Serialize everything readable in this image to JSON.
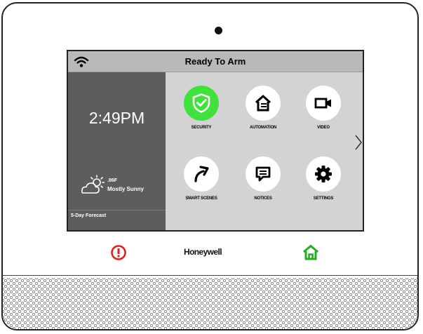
{
  "status_bar": {
    "title": "Ready To Arm",
    "wifi_icon": "wifi-icon"
  },
  "left_panel": {
    "time": "2:49PM",
    "weather": {
      "temperature": ".86F",
      "condition": "Mostly Sunny",
      "icon": "partly-sunny-icon"
    },
    "forecast_label": "5-Day Forecast"
  },
  "tiles": [
    {
      "label": "SECURITY",
      "icon": "shield-check-icon",
      "active": true
    },
    {
      "label": "AUTOMATION",
      "icon": "home-automation-icon",
      "active": false
    },
    {
      "label": "VIDEO",
      "icon": "video-camera-icon",
      "active": false
    },
    {
      "label": "SMART SCENES",
      "icon": "arrow-scene-icon",
      "active": false
    },
    {
      "label": "NOTICES",
      "icon": "message-icon",
      "active": false
    },
    {
      "label": "SETTINGS",
      "icon": "gear-icon",
      "active": false
    }
  ],
  "next_page_icon": "chevron-right-icon",
  "device": {
    "brand": "Honeywell",
    "alert_icon": "alert-icon",
    "home_icon": "home-icon",
    "colors": {
      "alert": "#e0201b",
      "home": "#22b022",
      "security_active": "#3fe23a"
    }
  }
}
